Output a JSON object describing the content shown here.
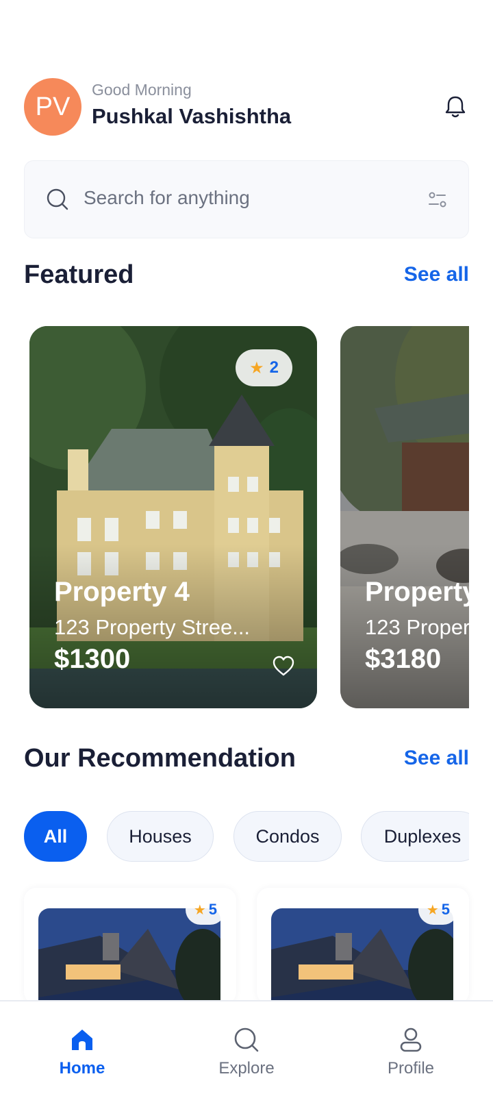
{
  "user": {
    "initials": "PV",
    "greeting": "Good Morning",
    "name": "Pushkal Vashishtha"
  },
  "search": {
    "placeholder": "Search for anything"
  },
  "featured": {
    "title": "Featured",
    "see_all": "See all",
    "cards": [
      {
        "name": "Property 4",
        "address": "123 Property Stree...",
        "price": "$1300",
        "rating": "2"
      },
      {
        "name": "Property",
        "address": "123 Proper",
        "price": "$3180",
        "rating": ""
      }
    ]
  },
  "recommendation": {
    "title": "Our Recommendation",
    "see_all": "See all",
    "filters": [
      "All",
      "Houses",
      "Condos",
      "Duplexes"
    ],
    "active_filter": "All",
    "cards": [
      {
        "rating": "5"
      },
      {
        "rating": "5"
      }
    ]
  },
  "nav": {
    "items": [
      {
        "label": "Home",
        "icon": "home-icon",
        "active": true
      },
      {
        "label": "Explore",
        "icon": "search-icon",
        "active": false
      },
      {
        "label": "Profile",
        "icon": "user-icon",
        "active": false
      }
    ]
  },
  "colors": {
    "accent": "#0a5fef",
    "avatar": "#f6895a",
    "star": "#f6a623"
  }
}
